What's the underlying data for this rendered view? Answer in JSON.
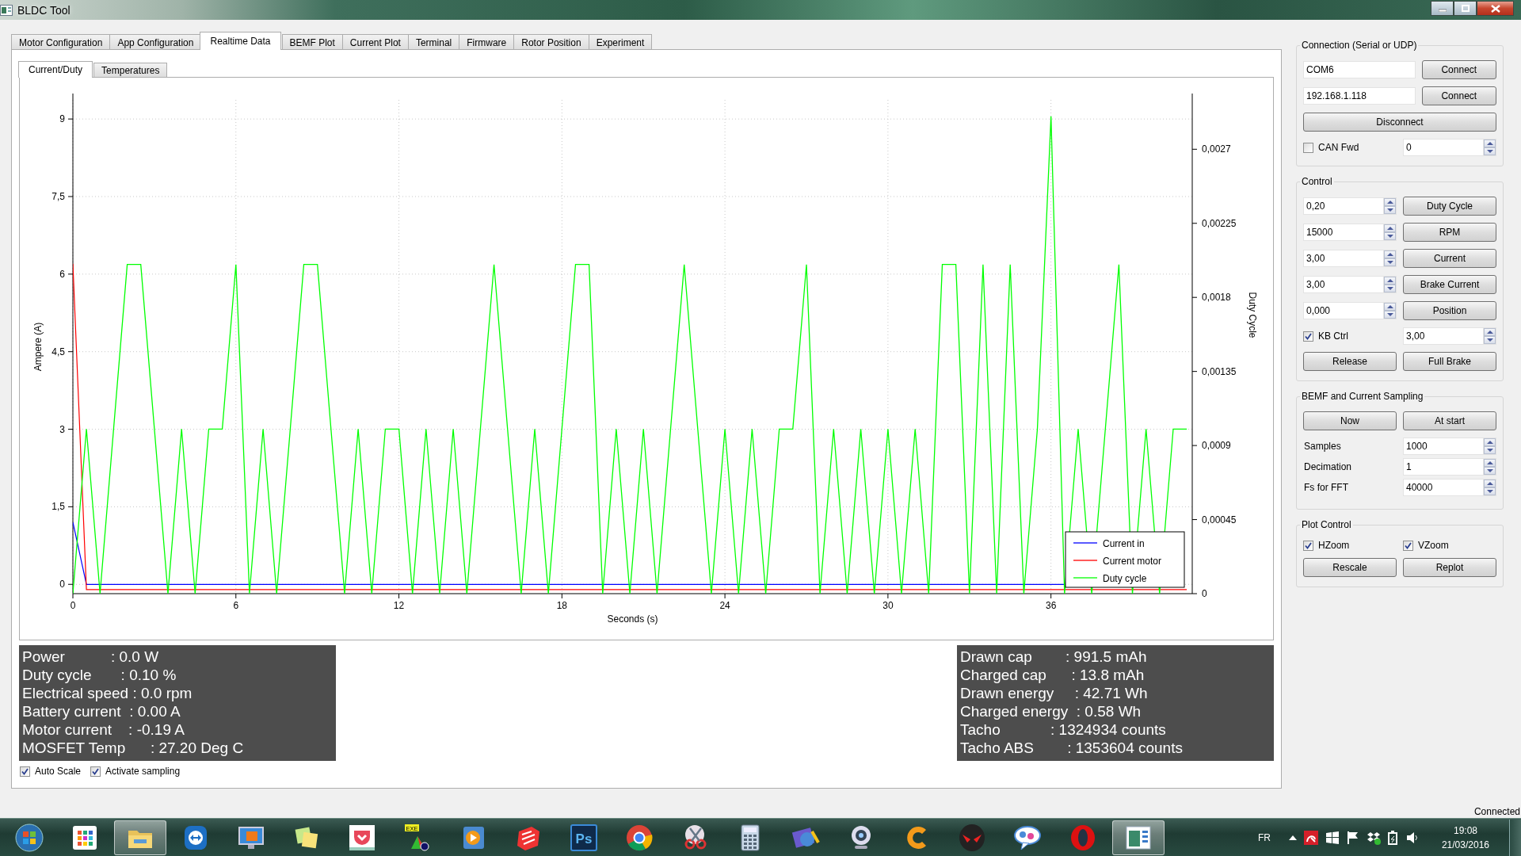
{
  "window": {
    "title": "BLDC Tool"
  },
  "tabs": [
    {
      "label": "Motor Configuration",
      "selected": false
    },
    {
      "label": "App Configuration",
      "selected": false
    },
    {
      "label": "Realtime Data",
      "selected": true
    },
    {
      "label": "BEMF Plot",
      "selected": false
    },
    {
      "label": "Current Plot",
      "selected": false
    },
    {
      "label": "Terminal",
      "selected": false
    },
    {
      "label": "Firmware",
      "selected": false
    },
    {
      "label": "Rotor Position",
      "selected": false
    },
    {
      "label": "Experiment",
      "selected": false
    }
  ],
  "subtabs": [
    {
      "label": "Current/Duty",
      "selected": true
    },
    {
      "label": "Temperatures",
      "selected": false
    }
  ],
  "chart": {
    "chart_data": {
      "type": "line",
      "grid": true,
      "legend": true,
      "xlabel": "Seconds (s)",
      "ylabel": "Ampere (A)",
      "y2label": "Duty Cycle",
      "xlim": [
        0,
        41.2
      ],
      "ylim": [
        -0.18,
        9.37
      ],
      "y2lim": [
        0,
        0.003
      ],
      "xticks": [
        0,
        6,
        12,
        18,
        24,
        30,
        36
      ],
      "yticks": [
        0,
        {
          "value": 1.5,
          "label": "1,5"
        },
        3,
        {
          "value": 4.5,
          "label": "4,5"
        },
        6,
        {
          "value": 7.5,
          "label": "7,5"
        },
        9
      ],
      "y2ticks": [
        0,
        {
          "value": 0.00045,
          "label": "0,00045"
        },
        {
          "value": 0.0009,
          "label": "0,0009"
        },
        {
          "value": 0.00135,
          "label": "0,00135"
        },
        {
          "value": 0.0018,
          "label": "0,0018"
        },
        {
          "value": 0.00225,
          "label": "0,00225"
        },
        {
          "value": 0.0027,
          "label": "0,0027"
        }
      ],
      "x": [
        0,
        0.5,
        1,
        1.5,
        2,
        2.5,
        3,
        3.5,
        4,
        4.5,
        5,
        5.5,
        6,
        6.5,
        7,
        7.5,
        8,
        8.5,
        9,
        9.5,
        10,
        10.5,
        11,
        11.5,
        12,
        12.5,
        13,
        13.5,
        14,
        14.5,
        15,
        15.5,
        16,
        16.5,
        17,
        17.5,
        18,
        18.5,
        19,
        19.5,
        20,
        20.5,
        21,
        21.5,
        22,
        22.5,
        23,
        23.5,
        24,
        24.5,
        25,
        25.5,
        26,
        26.5,
        27,
        27.5,
        28,
        28.5,
        29,
        29.5,
        30,
        30.5,
        31,
        31.5,
        32,
        32.5,
        33,
        33.5,
        34,
        34.5,
        35,
        35.5,
        36,
        36.5,
        37,
        37.5,
        38,
        38.5,
        39,
        39.5,
        40,
        40.5,
        41
      ],
      "series": [
        {
          "name": "Current in",
          "color": "#0000ff",
          "values": [
            1.2,
            0,
            0,
            0,
            0,
            0,
            0,
            0,
            0,
            0,
            0,
            0,
            0,
            0,
            0,
            0,
            0,
            0,
            0,
            0,
            0,
            0,
            0,
            0,
            0,
            0,
            0,
            0,
            0,
            0,
            0,
            0,
            0,
            0,
            0,
            0,
            0,
            0,
            0,
            0,
            0,
            0,
            0,
            0,
            0,
            0,
            0,
            0,
            0,
            0,
            0,
            0,
            0,
            0,
            0,
            0,
            0,
            0,
            0,
            0,
            0,
            0,
            0,
            0,
            0,
            0,
            0,
            0,
            0,
            0,
            0,
            0,
            0,
            0,
            null,
            null,
            null,
            null,
            null,
            null,
            null,
            null,
            null
          ]
        },
        {
          "name": "Current motor",
          "color": "#ff0000",
          "values": [
            6.2,
            -0.1,
            -0.1,
            -0.1,
            -0.1,
            -0.1,
            -0.1,
            -0.1,
            -0.1,
            -0.1,
            -0.1,
            -0.1,
            -0.1,
            -0.1,
            -0.1,
            -0.1,
            -0.1,
            -0.1,
            -0.1,
            -0.1,
            -0.1,
            -0.1,
            -0.1,
            -0.1,
            -0.1,
            -0.1,
            -0.1,
            -0.1,
            -0.1,
            -0.1,
            -0.1,
            -0.1,
            -0.1,
            -0.1,
            -0.1,
            -0.1,
            -0.1,
            -0.1,
            -0.1,
            -0.1,
            -0.1,
            -0.1,
            -0.1,
            -0.1,
            -0.1,
            -0.1,
            -0.1,
            -0.1,
            -0.1,
            -0.1,
            -0.1,
            -0.1,
            -0.1,
            -0.1,
            -0.1,
            -0.1,
            -0.1,
            -0.1,
            -0.1,
            -0.1,
            -0.1,
            -0.1,
            -0.1,
            -0.1,
            -0.1,
            -0.1,
            -0.1,
            -0.1,
            -0.1,
            -0.1,
            -0.1,
            -0.1,
            -0.1,
            -0.1,
            -0.1,
            -0.1,
            -0.1,
            -0.1,
            -0.1,
            -0.1,
            -0.1,
            -0.1,
            -0.1
          ]
        },
        {
          "name": "Duty cycle",
          "color": "#00ff00",
          "axis": "y2",
          "values": [
            0,
            0.001,
            0,
            0.001,
            0.002,
            0.002,
            0.001,
            0,
            0.001,
            0,
            0.001,
            0.001,
            0.002,
            0,
            0.001,
            0,
            0.001,
            0.002,
            0.002,
            0.001,
            0,
            0.001,
            0,
            0.001,
            0.001,
            0,
            0.001,
            0,
            0.001,
            0,
            0.001,
            0.002,
            0.001,
            0,
            0.001,
            0,
            0.001,
            0.002,
            0.002,
            0,
            0.001,
            0,
            0.001,
            0,
            0.001,
            0.002,
            0.001,
            0,
            0.001,
            0,
            0.001,
            0,
            0.001,
            0.001,
            0.002,
            0,
            0.001,
            0,
            0.001,
            0,
            0.001,
            0,
            0.001,
            0,
            0.002,
            0.002,
            0,
            0.002,
            0,
            0.002,
            0,
            0.001,
            0.0029,
            0,
            0.001,
            0,
            0.001,
            0.002,
            0,
            0.001,
            0,
            0.001,
            0.001
          ]
        }
      ]
    }
  },
  "readouts_left": [
    "Power           : 0.0 W",
    "Duty cycle       : 0.10 %",
    "Electrical speed : 0.0 rpm",
    "Battery current  : 0.00 A",
    "Motor current    : -0.19 A",
    "MOSFET Temp      : 27.20 Deg C"
  ],
  "readouts_right": [
    "Drawn cap        : 991.5 mAh",
    "Charged cap      : 13.8 mAh",
    "Drawn energy     : 42.71 Wh",
    "Charged energy  : 0.58 Wh",
    "Tacho            : 1324934 counts",
    "Tacho ABS        : 1353604 counts"
  ],
  "options": [
    {
      "label": "Auto Scale",
      "checked": true
    },
    {
      "label": "Activate sampling",
      "checked": true
    }
  ],
  "sidebar": {
    "groups": [
      {
        "title": "Connection (Serial or UDP)",
        "rows": [
          [
            {
              "kind": "input",
              "value": "COM6"
            },
            {
              "kind": "button",
              "label": "Connect"
            }
          ],
          [
            {
              "kind": "input",
              "value": "192.168.1.118"
            },
            {
              "kind": "button",
              "label": "Connect"
            }
          ],
          [
            {
              "kind": "button",
              "label": "Disconnect"
            }
          ],
          [
            {
              "kind": "check",
              "label": "CAN Fwd",
              "checked": false
            },
            {
              "kind": "spin",
              "value": "0"
            }
          ]
        ]
      },
      {
        "title": "Control",
        "rows": [
          [
            {
              "kind": "spin",
              "value": "0,20"
            },
            {
              "kind": "button",
              "label": "Duty Cycle"
            }
          ],
          [
            {
              "kind": "spin",
              "value": "15000"
            },
            {
              "kind": "button",
              "label": "RPM"
            }
          ],
          [
            {
              "kind": "spin",
              "value": "3,00"
            },
            {
              "kind": "button",
              "label": "Current"
            }
          ],
          [
            {
              "kind": "spin",
              "value": "3,00"
            },
            {
              "kind": "button",
              "label": "Brake Current"
            }
          ],
          [
            {
              "kind": "spin",
              "value": "0,000"
            },
            {
              "kind": "button",
              "label": "Position"
            }
          ],
          [
            {
              "kind": "check",
              "label": "KB Ctrl",
              "checked": true
            },
            {
              "kind": "spin",
              "value": "3,00"
            }
          ],
          [
            {
              "kind": "button",
              "label": "Release"
            },
            {
              "kind": "button",
              "label": "Full Brake"
            }
          ]
        ]
      },
      {
        "title": "BEMF and Current Sampling",
        "rows": [
          [
            {
              "kind": "button",
              "label": "Now"
            },
            {
              "kind": "button",
              "label": "At start"
            }
          ],
          [
            {
              "kind": "label",
              "text": "Samples"
            },
            {
              "kind": "spin",
              "value": "1000"
            }
          ],
          [
            {
              "kind": "label",
              "text": "Decimation"
            },
            {
              "kind": "spin",
              "value": "1"
            }
          ],
          [
            {
              "kind": "label",
              "text": "Fs for FFT"
            },
            {
              "kind": "spin",
              "value": "40000"
            }
          ]
        ]
      },
      {
        "title": "Plot Control",
        "rows": [
          [
            {
              "kind": "check",
              "label": "HZoom",
              "checked": true
            },
            {
              "kind": "check",
              "label": "VZoom",
              "checked": true
            }
          ],
          [
            {
              "kind": "button",
              "label": "Rescale"
            },
            {
              "kind": "button",
              "label": "Replot"
            }
          ]
        ]
      }
    ]
  },
  "status_bar": {
    "text": "Connected"
  },
  "taskbar": {
    "items": [
      {
        "kind": "start",
        "open": false
      },
      {
        "kind": "apps",
        "open": false
      },
      {
        "kind": "folder",
        "open": true
      },
      {
        "kind": "remote",
        "open": false
      },
      {
        "kind": "monitor",
        "open": false
      },
      {
        "kind": "notes",
        "open": false
      },
      {
        "kind": "pocket",
        "open": false
      },
      {
        "kind": "exe",
        "label": "EXE",
        "open": false
      },
      {
        "kind": "player",
        "open": false
      },
      {
        "kind": "sketch",
        "open": false
      },
      {
        "kind": "photo",
        "label": "Ps",
        "open": false
      },
      {
        "kind": "browser",
        "open": false
      },
      {
        "kind": "scissors",
        "open": false
      },
      {
        "kind": "calculator",
        "open": false
      },
      {
        "kind": "film",
        "open": false
      },
      {
        "kind": "webcam",
        "open": false
      },
      {
        "kind": "crescent",
        "open": false
      },
      {
        "kind": "alien",
        "open": false
      },
      {
        "kind": "comic",
        "open": false
      },
      {
        "kind": "ring",
        "open": false
      },
      {
        "kind": "bldc",
        "open": true
      }
    ],
    "tray": {
      "language": "FR",
      "time": "19:08",
      "date": "21/03/2016"
    }
  }
}
